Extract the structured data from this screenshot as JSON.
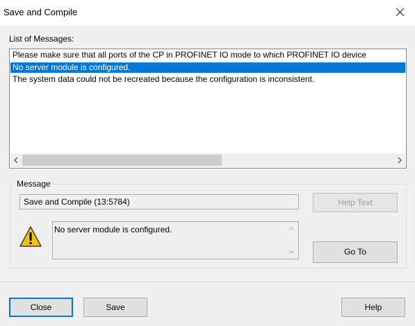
{
  "window": {
    "title": "Save and Compile"
  },
  "list": {
    "label": "List of Messages:",
    "items": [
      "Please make sure that all ports of the CP in PROFINET IO mode to which PROFINET IO device",
      "No server module is configured.",
      "The system data could not be recreated because the configuration is inconsistent."
    ]
  },
  "message": {
    "group_label": "Message",
    "source": "Save and Compile (13:5784)",
    "text": "No server module is configured.",
    "help_text_label": "Help Text",
    "goto_label": "Go To"
  },
  "footer": {
    "close_label": "Close",
    "save_label": "Save",
    "help_label": "Help"
  },
  "icons": {
    "warning": "warning-icon",
    "close": "close-icon",
    "scroll_left": "chevron-left-icon",
    "scroll_right": "chevron-right-icon",
    "scroll_up": "chevron-up-icon",
    "scroll_down": "chevron-down-icon"
  },
  "colors": {
    "selection": "#0078d7",
    "background": "#f0f0f0"
  }
}
